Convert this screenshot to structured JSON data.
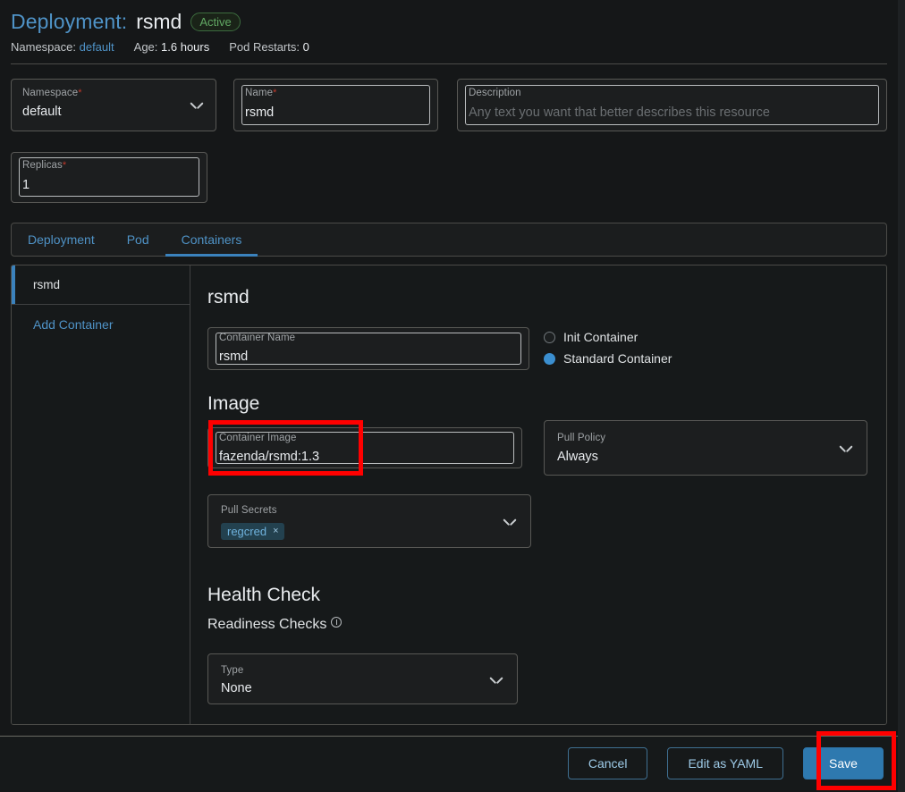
{
  "header": {
    "title_prefix": "Deployment:",
    "title_name": "rsmd",
    "status_badge": "Active",
    "meta": {
      "namespace_label": "Namespace:",
      "namespace_value": "default",
      "age_label": "Age:",
      "age_value": "1.6 hours",
      "restarts_label": "Pod Restarts:",
      "restarts_value": "0"
    }
  },
  "form": {
    "namespace": {
      "label": "Namespace",
      "required": "*",
      "value": "default"
    },
    "name": {
      "label": "Name",
      "required": "*",
      "value": "rsmd"
    },
    "description": {
      "label": "Description",
      "placeholder": "Any text you want that better describes this resource"
    },
    "replicas": {
      "label": "Replicas",
      "required": "*",
      "value": "1"
    }
  },
  "tabs": [
    {
      "label": "Deployment",
      "active": false
    },
    {
      "label": "Pod",
      "active": false
    },
    {
      "label": "Containers",
      "active": true
    }
  ],
  "containers_panel": {
    "sidebar": {
      "items": [
        {
          "label": "rsmd",
          "selected": true
        }
      ],
      "add_label": "Add Container"
    },
    "body": {
      "heading": "rsmd",
      "container_name": {
        "label": "Container Name",
        "value": "rsmd"
      },
      "container_type": {
        "init": {
          "label": "Init Container",
          "checked": false
        },
        "standard": {
          "label": "Standard Container",
          "checked": true
        }
      },
      "image_section_title": "Image",
      "container_image": {
        "label": "Container Image",
        "value": "fazenda/rsmd:1.3"
      },
      "pull_policy": {
        "label": "Pull Policy",
        "value": "Always"
      },
      "pull_secrets": {
        "label": "Pull Secrets",
        "chip": "regcred",
        "chip_remove": "×"
      },
      "health_check_title": "Health Check",
      "readiness_checks_title": "Readiness Checks",
      "readiness_type": {
        "label": "Type",
        "value": "None"
      }
    }
  },
  "footer": {
    "cancel_label": "Cancel",
    "edit_yaml_label": "Edit as YAML",
    "save_label": "Save"
  },
  "colors": {
    "accent_blue": "#4f93c7",
    "primary_button": "#2e79af",
    "status_green": "#61a863",
    "annotation_red": "#ff0000",
    "background": "#151718"
  }
}
